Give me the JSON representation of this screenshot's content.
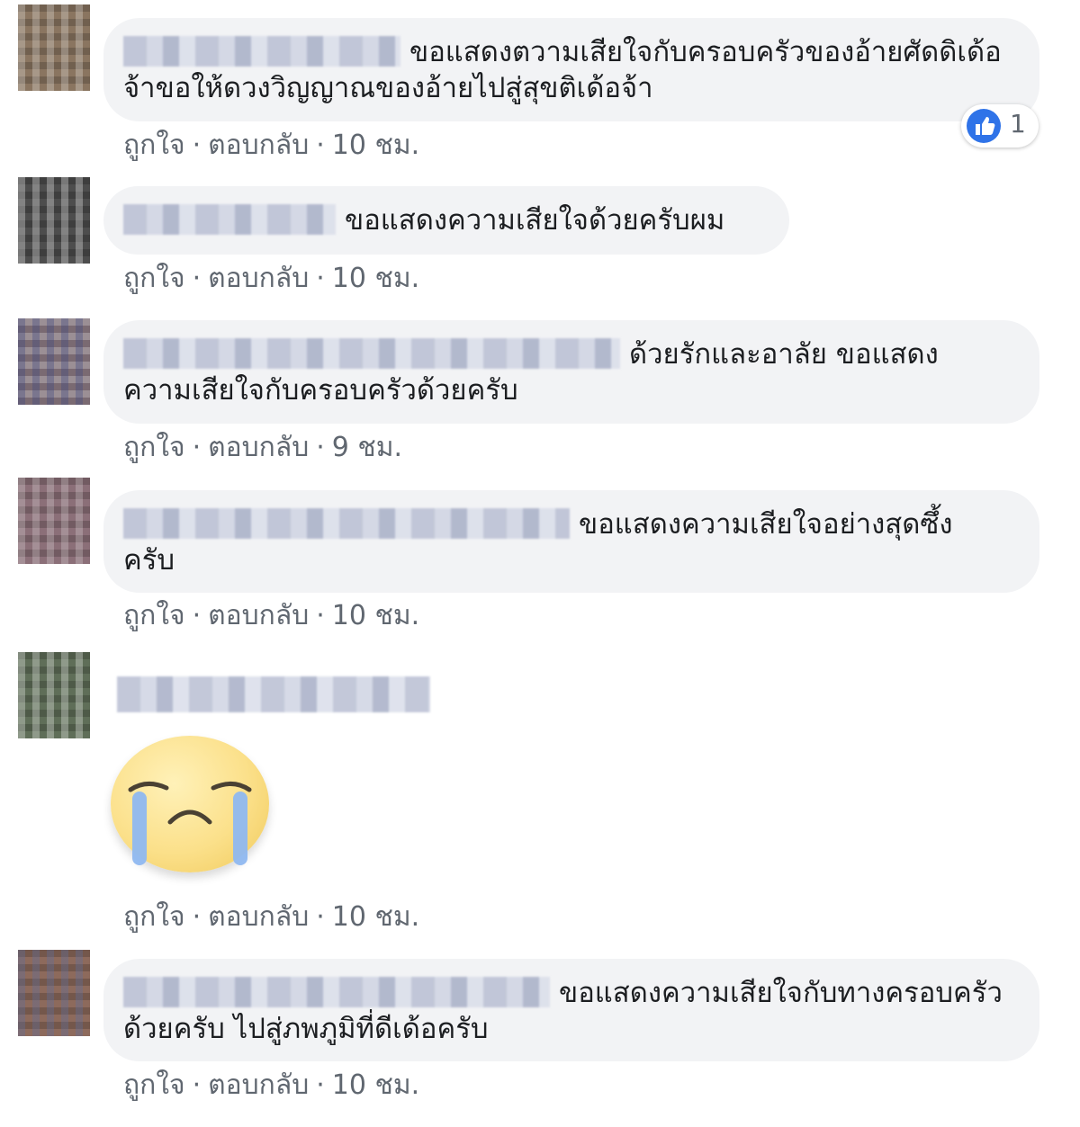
{
  "comments": [
    {
      "text": "ขอแสดงตวามเสียใจกับครอบครัวของอ้ายศัดดิเด้อจ้าขอให้ดวงวิญญาณของอ้ายไปสู่สุขติเด้อจ้า",
      "like_label": "ถูกใจ",
      "reply_label": "ตอบกลับ",
      "time": "10 ชม.",
      "reaction_count": "1"
    },
    {
      "text": "ขอแสดงความเสียใจด้วยครับผม",
      "like_label": "ถูกใจ",
      "reply_label": "ตอบกลับ",
      "time": "10 ชม."
    },
    {
      "text": "ด้วยรักและอาลัย ขอแสดงความเสียใจกับครอบครัวด้วยครับ",
      "like_label": "ถูกใจ",
      "reply_label": "ตอบกลับ",
      "time": "9 ชม."
    },
    {
      "text": "ขอแสดงความเสียใจอย่างสุดซึ้งครับ",
      "like_label": "ถูกใจ",
      "reply_label": "ตอบกลับ",
      "time": "10 ชม."
    },
    {
      "text": "",
      "sticker": "crying-face-sticker",
      "like_label": "ถูกใจ",
      "reply_label": "ตอบกลับ",
      "time": "10 ชม."
    },
    {
      "text": "ขอแสดงความเสียใจกับทางครอบครัวด้วยครับ ไปสู่ภพภูมิที่ดีเด้อครับ",
      "like_label": "ถูกใจ",
      "reply_label": "ตอบกลับ",
      "time": "10 ชม."
    }
  ],
  "icons": {
    "like": "like-thumb-icon",
    "sticker": "crying-face-sticker"
  },
  "colors": {
    "bubble": "#f2f3f5",
    "meta_text": "#606770",
    "like_blue": "#2f73e8"
  }
}
